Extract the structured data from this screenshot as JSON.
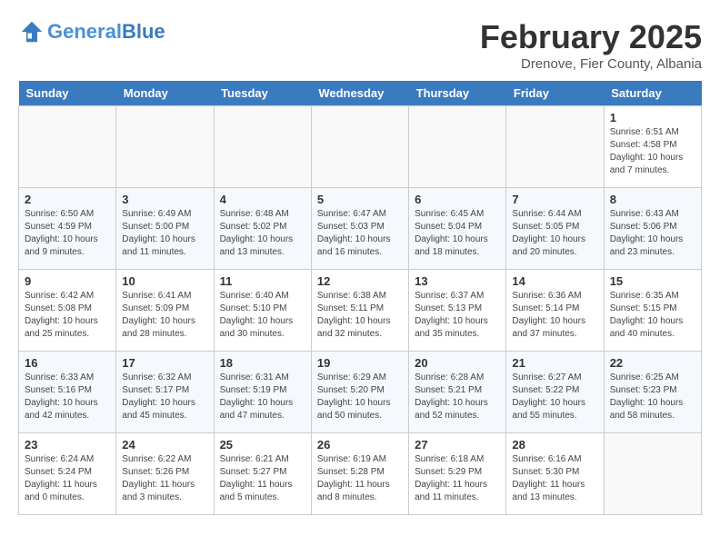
{
  "header": {
    "logo_line1": "General",
    "logo_line2": "Blue",
    "month": "February 2025",
    "location": "Drenove, Fier County, Albania"
  },
  "days_of_week": [
    "Sunday",
    "Monday",
    "Tuesday",
    "Wednesday",
    "Thursday",
    "Friday",
    "Saturday"
  ],
  "weeks": [
    [
      {
        "day": "",
        "info": ""
      },
      {
        "day": "",
        "info": ""
      },
      {
        "day": "",
        "info": ""
      },
      {
        "day": "",
        "info": ""
      },
      {
        "day": "",
        "info": ""
      },
      {
        "day": "",
        "info": ""
      },
      {
        "day": "1",
        "info": "Sunrise: 6:51 AM\nSunset: 4:58 PM\nDaylight: 10 hours\nand 7 minutes."
      }
    ],
    [
      {
        "day": "2",
        "info": "Sunrise: 6:50 AM\nSunset: 4:59 PM\nDaylight: 10 hours\nand 9 minutes."
      },
      {
        "day": "3",
        "info": "Sunrise: 6:49 AM\nSunset: 5:00 PM\nDaylight: 10 hours\nand 11 minutes."
      },
      {
        "day": "4",
        "info": "Sunrise: 6:48 AM\nSunset: 5:02 PM\nDaylight: 10 hours\nand 13 minutes."
      },
      {
        "day": "5",
        "info": "Sunrise: 6:47 AM\nSunset: 5:03 PM\nDaylight: 10 hours\nand 16 minutes."
      },
      {
        "day": "6",
        "info": "Sunrise: 6:45 AM\nSunset: 5:04 PM\nDaylight: 10 hours\nand 18 minutes."
      },
      {
        "day": "7",
        "info": "Sunrise: 6:44 AM\nSunset: 5:05 PM\nDaylight: 10 hours\nand 20 minutes."
      },
      {
        "day": "8",
        "info": "Sunrise: 6:43 AM\nSunset: 5:06 PM\nDaylight: 10 hours\nand 23 minutes."
      }
    ],
    [
      {
        "day": "9",
        "info": "Sunrise: 6:42 AM\nSunset: 5:08 PM\nDaylight: 10 hours\nand 25 minutes."
      },
      {
        "day": "10",
        "info": "Sunrise: 6:41 AM\nSunset: 5:09 PM\nDaylight: 10 hours\nand 28 minutes."
      },
      {
        "day": "11",
        "info": "Sunrise: 6:40 AM\nSunset: 5:10 PM\nDaylight: 10 hours\nand 30 minutes."
      },
      {
        "day": "12",
        "info": "Sunrise: 6:38 AM\nSunset: 5:11 PM\nDaylight: 10 hours\nand 32 minutes."
      },
      {
        "day": "13",
        "info": "Sunrise: 6:37 AM\nSunset: 5:13 PM\nDaylight: 10 hours\nand 35 minutes."
      },
      {
        "day": "14",
        "info": "Sunrise: 6:36 AM\nSunset: 5:14 PM\nDaylight: 10 hours\nand 37 minutes."
      },
      {
        "day": "15",
        "info": "Sunrise: 6:35 AM\nSunset: 5:15 PM\nDaylight: 10 hours\nand 40 minutes."
      }
    ],
    [
      {
        "day": "16",
        "info": "Sunrise: 6:33 AM\nSunset: 5:16 PM\nDaylight: 10 hours\nand 42 minutes."
      },
      {
        "day": "17",
        "info": "Sunrise: 6:32 AM\nSunset: 5:17 PM\nDaylight: 10 hours\nand 45 minutes."
      },
      {
        "day": "18",
        "info": "Sunrise: 6:31 AM\nSunset: 5:19 PM\nDaylight: 10 hours\nand 47 minutes."
      },
      {
        "day": "19",
        "info": "Sunrise: 6:29 AM\nSunset: 5:20 PM\nDaylight: 10 hours\nand 50 minutes."
      },
      {
        "day": "20",
        "info": "Sunrise: 6:28 AM\nSunset: 5:21 PM\nDaylight: 10 hours\nand 52 minutes."
      },
      {
        "day": "21",
        "info": "Sunrise: 6:27 AM\nSunset: 5:22 PM\nDaylight: 10 hours\nand 55 minutes."
      },
      {
        "day": "22",
        "info": "Sunrise: 6:25 AM\nSunset: 5:23 PM\nDaylight: 10 hours\nand 58 minutes."
      }
    ],
    [
      {
        "day": "23",
        "info": "Sunrise: 6:24 AM\nSunset: 5:24 PM\nDaylight: 11 hours\nand 0 minutes."
      },
      {
        "day": "24",
        "info": "Sunrise: 6:22 AM\nSunset: 5:26 PM\nDaylight: 11 hours\nand 3 minutes."
      },
      {
        "day": "25",
        "info": "Sunrise: 6:21 AM\nSunset: 5:27 PM\nDaylight: 11 hours\nand 5 minutes."
      },
      {
        "day": "26",
        "info": "Sunrise: 6:19 AM\nSunset: 5:28 PM\nDaylight: 11 hours\nand 8 minutes."
      },
      {
        "day": "27",
        "info": "Sunrise: 6:18 AM\nSunset: 5:29 PM\nDaylight: 11 hours\nand 11 minutes."
      },
      {
        "day": "28",
        "info": "Sunrise: 6:16 AM\nSunset: 5:30 PM\nDaylight: 11 hours\nand 13 minutes."
      },
      {
        "day": "",
        "info": ""
      }
    ]
  ]
}
